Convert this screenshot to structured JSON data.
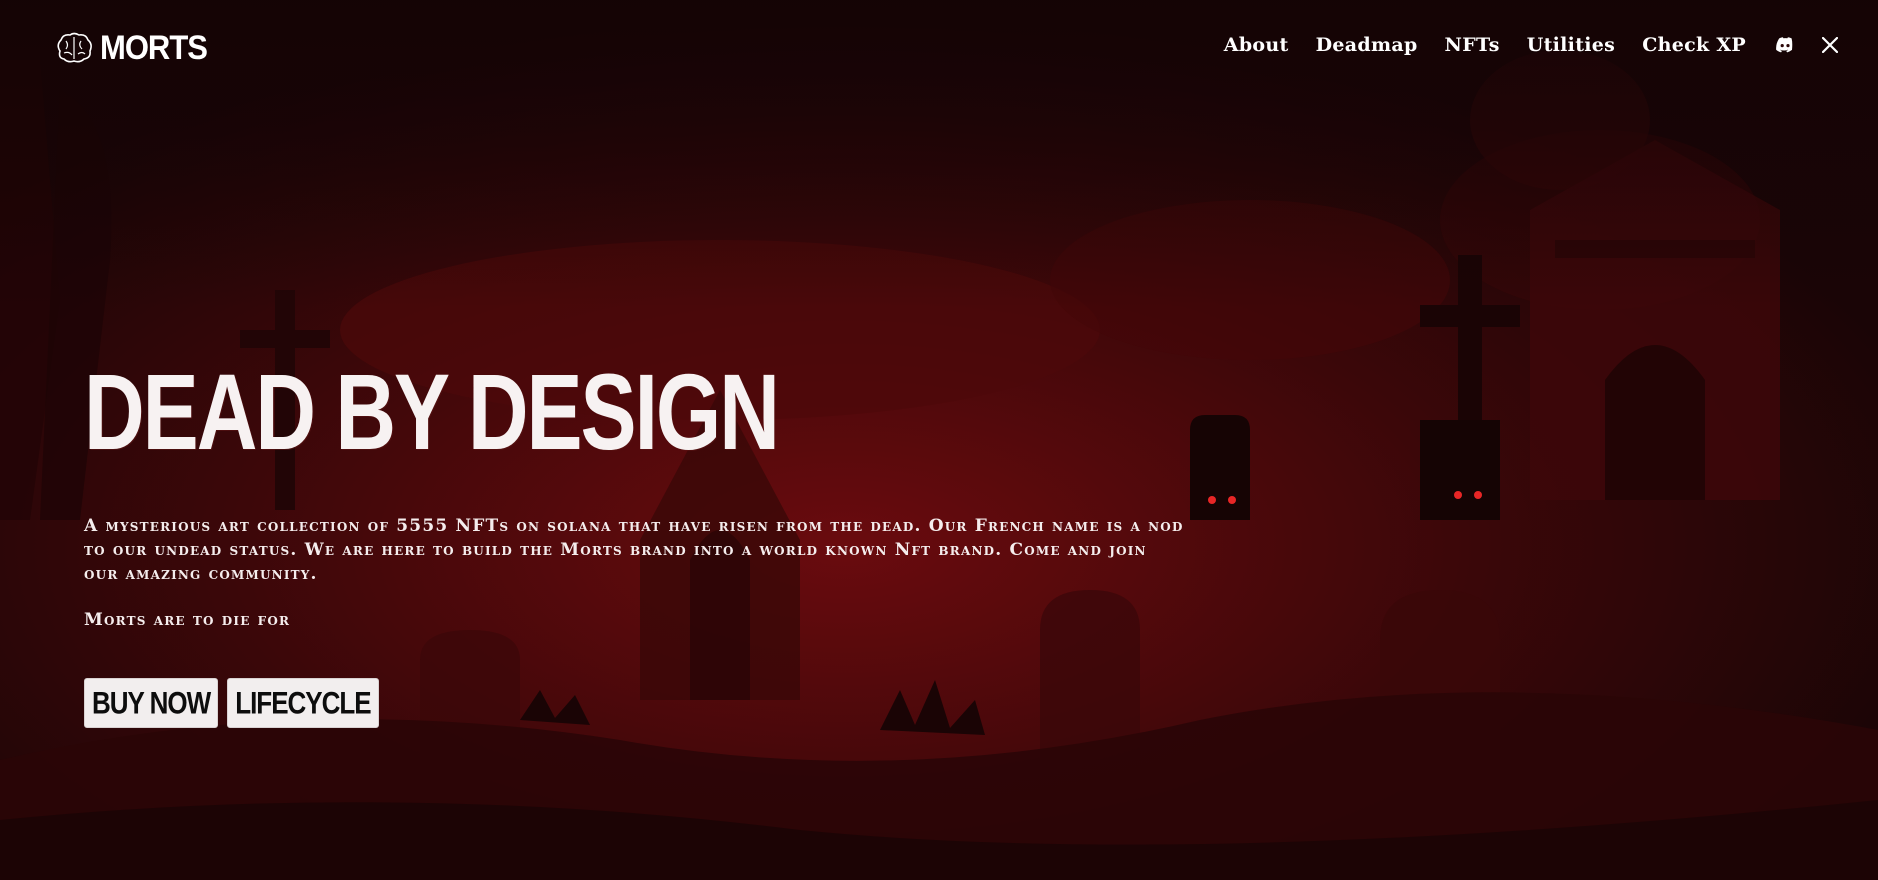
{
  "header": {
    "brand_name": "MORTS",
    "brand_icon": "brain-icon",
    "nav": [
      {
        "label": "About"
      },
      {
        "label": "Deadmap"
      },
      {
        "label": "NFTs"
      },
      {
        "label": "Utilities"
      },
      {
        "label": "Check XP"
      }
    ],
    "social_icons": [
      "discord-icon",
      "x-icon"
    ]
  },
  "hero": {
    "title": "DEAD BY DESIGN",
    "description": "A mysterious art collection of 5555 NFTs on solana that have risen from the dead. Our French name is a nod to our undead status. We are here to build the Morts brand into a world known Nft brand. Come and join our amazing community.",
    "tagline": "Morts are to die for",
    "buttons": {
      "buy_now": "BUY NOW",
      "lifecycle": "LIFECYCLE"
    }
  },
  "colors": {
    "background_dark": "#1a0606",
    "background_red": "#5a0a0c",
    "text": "#ffffff",
    "button_bg": "#f2eeee"
  }
}
